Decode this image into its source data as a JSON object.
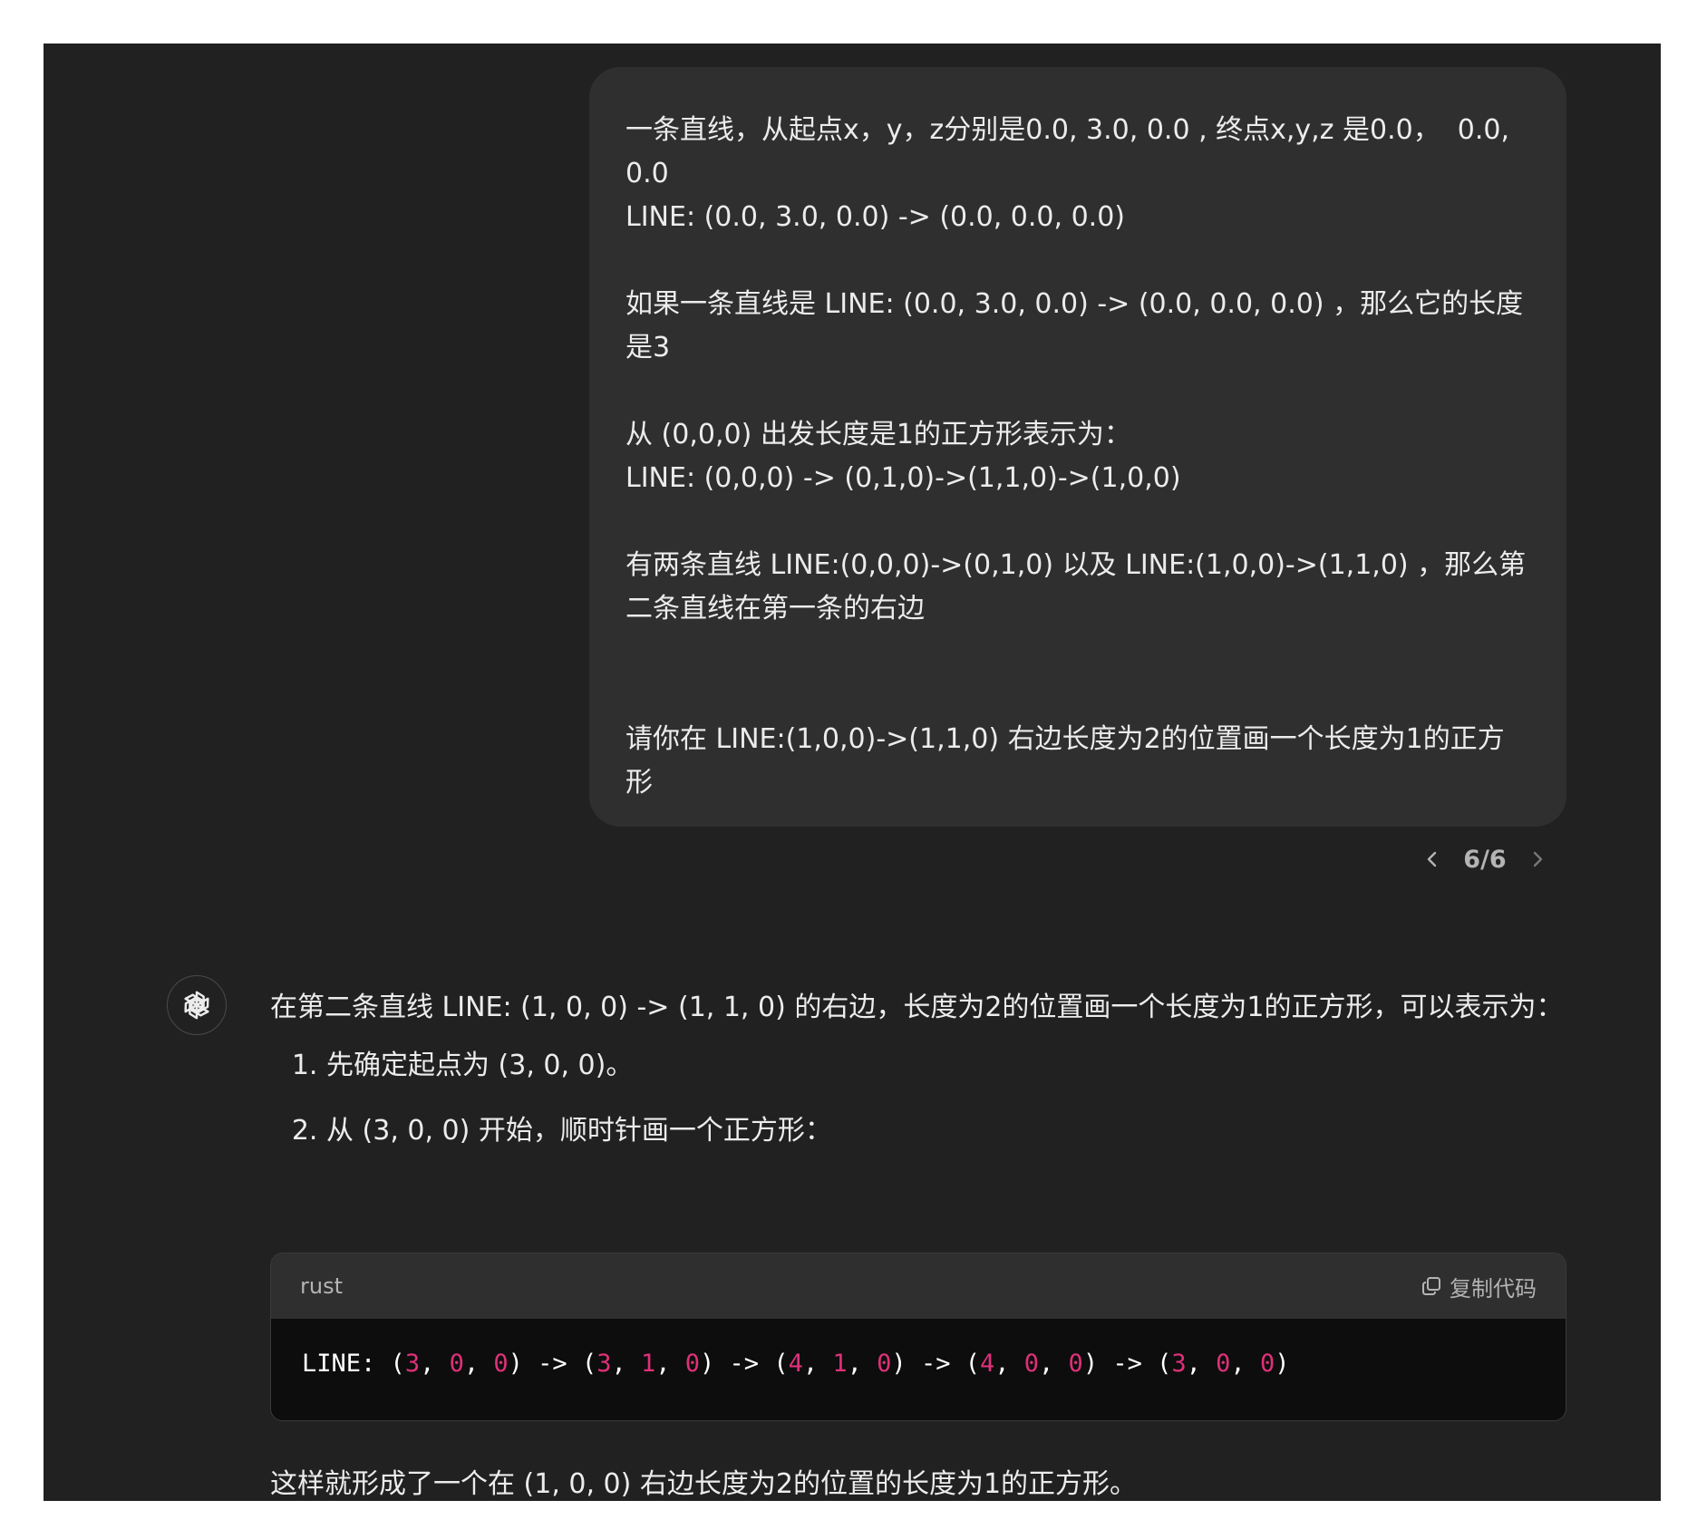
{
  "user_message": {
    "paragraphs": [
      "一条直线，从起点x，y，z分别是0.0, 3.0, 0.0 , 终点x,y,z 是0.0，  0.0, 0.0\nLINE: (0.0, 3.0, 0.0) -> (0.0, 0.0, 0.0)",
      "如果一条直线是 LINE: (0.0, 3.0, 0.0) -> (0.0, 0.0, 0.0) ，那么它的长度是3",
      "从 (0,0,0) 出发长度是1的正方形表示为：\nLINE: (0,0,0) -> (0,1,0)->(1,1,0)->(1,0,0)",
      "有两条直线 LINE:(0,0,0)->(0,1,0) 以及 LINE:(1,0,0)->(1,1,0) ，那么第二条直线在第一条的右边",
      "请你在 LINE:(1,0,0)->(1,1,0) 右边长度为2的位置画一个长度为1的正方形"
    ]
  },
  "version_nav": {
    "count": "6/6",
    "prev_icon": "chevron-left-icon",
    "next_icon": "chevron-right-icon"
  },
  "assistant": {
    "avatar_icon": "openai-logo-icon",
    "intro": "在第二条直线 LINE: (1, 0, 0) -> (1, 1, 0) 的右边，长度为2的位置画一个长度为1的正方形，可以表示为：",
    "steps": [
      "先确定起点为 (3, 0, 0)。",
      "从 (3, 0, 0) 开始，顺时针画一个正方形："
    ],
    "code": {
      "language": "rust",
      "copy_label": "复制代码",
      "copy_icon": "copy-icon",
      "keyword": "LINE:",
      "points": [
        [
          "3",
          "0",
          "0"
        ],
        [
          "3",
          "1",
          "0"
        ],
        [
          "4",
          "1",
          "0"
        ],
        [
          "4",
          "0",
          "0"
        ],
        [
          "3",
          "0",
          "0"
        ]
      ],
      "number_color": "#df3079"
    },
    "conclusion": "这样就形成了一个在 (1, 0, 0) 右边长度为2的位置的长度为1的正方形。"
  },
  "colors": {
    "page_background": "#212121",
    "user_bubble": "#2f2f2f",
    "code_background": "#0d0d0d",
    "text": "#ececec"
  }
}
